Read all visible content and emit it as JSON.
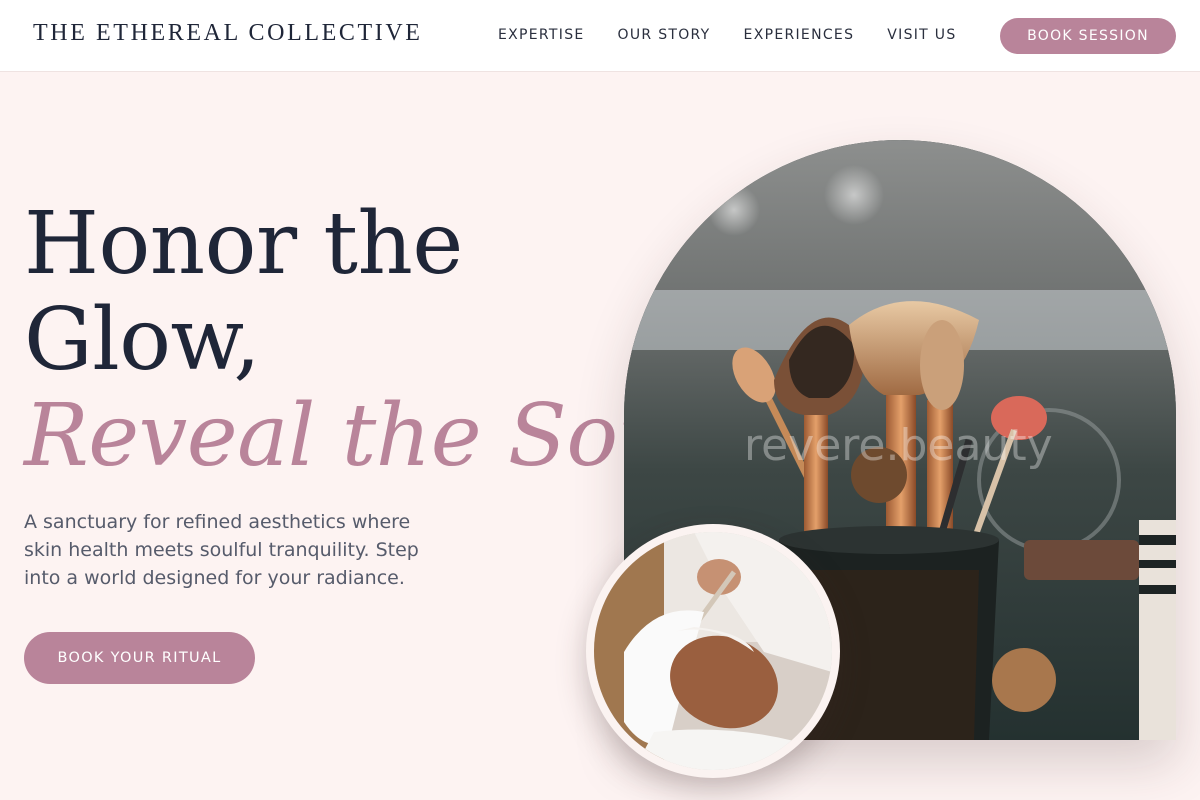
{
  "brand": {
    "name": "THE ETHEREAL COLLECTIVE"
  },
  "nav": {
    "links": [
      "EXPERTISE",
      "OUR STORY",
      "EXPERIENCES",
      "VISIT US"
    ],
    "cta_label": "BOOK SESSION"
  },
  "hero": {
    "headline_line1": "Honor the",
    "headline_line2": "Glow,",
    "headline_accent": "Reveal the Soul.",
    "subtext": "A sanctuary for refined aesthetics where skin health meets soulful tranquility. Step into a world designed for your radiance.",
    "cta_label": "BOOK YOUR RITUAL"
  },
  "images": {
    "arch_alt": "Makeup brushes in a holder",
    "arch_watermark": "revere.beauty",
    "circle_alt": "Woman receiving a facial mask treatment"
  },
  "colors": {
    "accent": "#b9849a",
    "headline": "#1f2638",
    "background": "#fdf3f2",
    "body_text": "#565b6b"
  }
}
